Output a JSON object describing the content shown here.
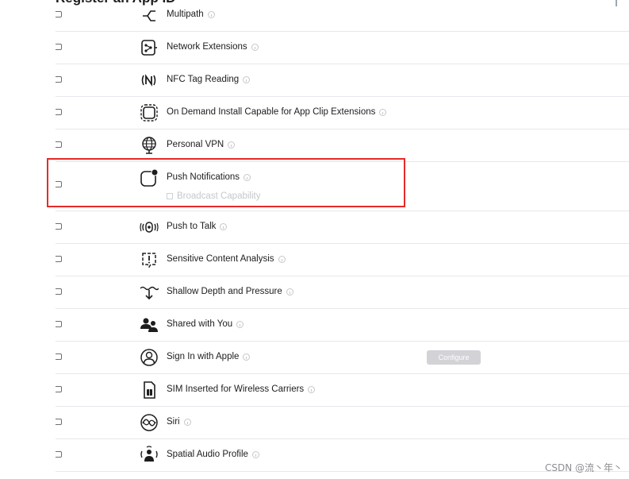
{
  "page": {
    "title": "Register an App ID"
  },
  "capabilities": [
    {
      "label": "Multipath",
      "icon": "multipath-icon"
    },
    {
      "label": "Network Extensions",
      "icon": "network-extensions-icon"
    },
    {
      "label": "NFC Tag Reading",
      "icon": "nfc-icon"
    },
    {
      "label": "On Demand Install Capable for App Clip Extensions",
      "icon": "app-clip-icon"
    },
    {
      "label": "Personal VPN",
      "icon": "globe-icon"
    },
    {
      "label": "Push Notifications",
      "icon": "push-notifications-icon",
      "sub_option": "Broadcast Capability"
    },
    {
      "label": "Push to Talk",
      "icon": "push-to-talk-icon"
    },
    {
      "label": "Sensitive Content Analysis",
      "icon": "sensitive-content-icon"
    },
    {
      "label": "Shallow Depth and Pressure",
      "icon": "shallow-depth-icon"
    },
    {
      "label": "Shared with You",
      "icon": "shared-with-you-icon"
    },
    {
      "label": "Sign In with Apple",
      "icon": "sign-in-apple-icon",
      "button": "Configure"
    },
    {
      "label": "SIM Inserted for Wireless Carriers",
      "icon": "sim-card-icon"
    },
    {
      "label": "Siri",
      "icon": "siri-icon"
    },
    {
      "label": "Spatial Audio Profile",
      "icon": "spatial-audio-icon"
    }
  ],
  "watermark": "CSDN @流丶年丶",
  "colors": {
    "highlight": "#e62a2a",
    "divider": "#e8e8ed",
    "button_disabled": "#d2d2d7"
  }
}
